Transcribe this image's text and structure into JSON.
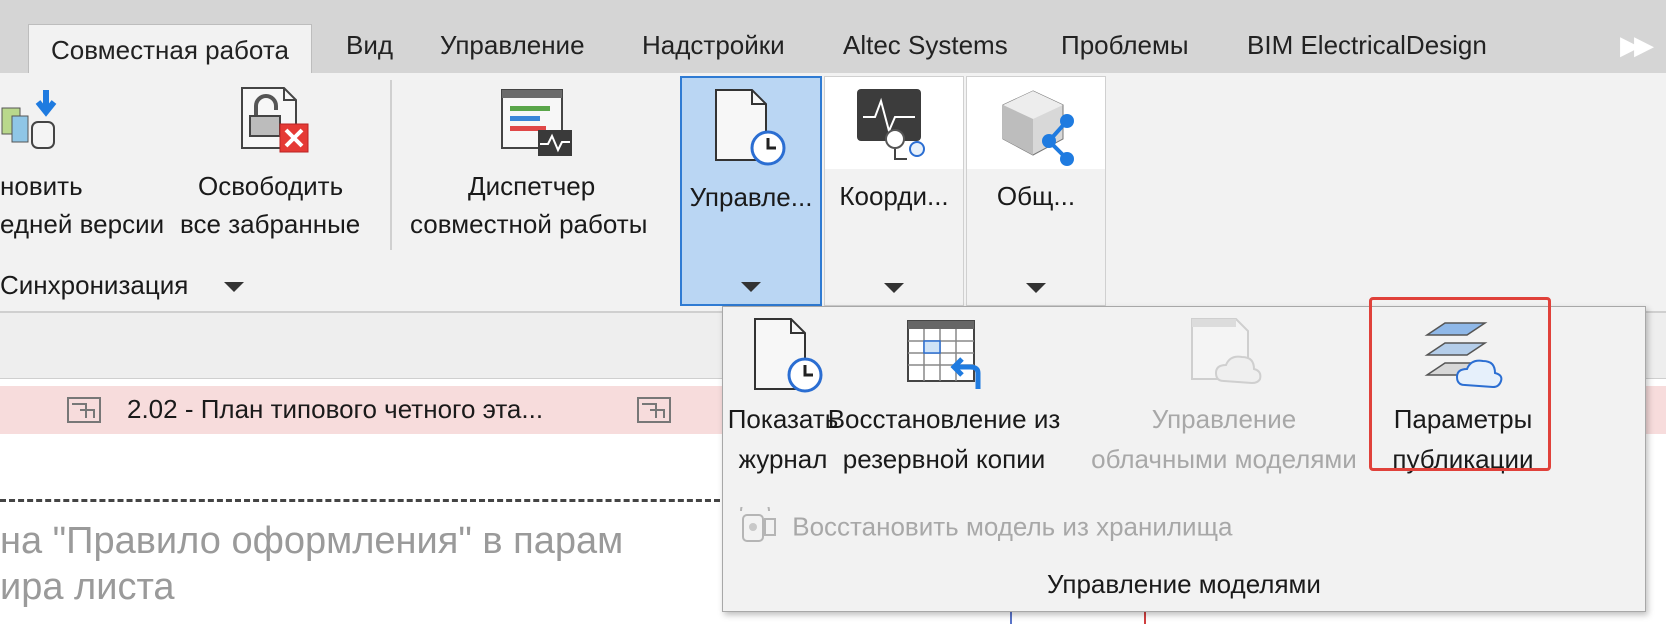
{
  "tabs": [
    {
      "label": "Совместная работа",
      "active": true
    },
    {
      "label": "Вид"
    },
    {
      "label": "Управление"
    },
    {
      "label": "Надстройки"
    },
    {
      "label": "Altec Systems"
    },
    {
      "label": "Проблемы"
    },
    {
      "label": "BIM ElectricalDesign"
    }
  ],
  "more_tabs_icon": "double-chevron-right-icon",
  "ribbon": {
    "update": {
      "line1": "новить",
      "line2": "едней версии"
    },
    "relinquish": {
      "line1": "Освободить",
      "line2": "все забранные"
    },
    "worksharing_monitor": {
      "line1": "Диспетчер",
      "line2": "совместной работы"
    },
    "manage_models_btn": "Управле...",
    "coordination_btn": "Коорди...",
    "sharing_btn": "Общ...",
    "sync_panel": "Синхронизация"
  },
  "view": {
    "sheet_row": "2.02 - План типового четного эта...",
    "big_text_line1": "на \"Правило оформления\" в парам",
    "big_text_line2": "ира листа"
  },
  "dropdown": {
    "items": [
      {
        "line1": "Показать",
        "line2": "журнал",
        "enabled": true
      },
      {
        "line1": "Восстановление из",
        "line2": "резервной копии",
        "enabled": true
      },
      {
        "line1": "Управление",
        "line2": "облачными моделями",
        "enabled": false
      },
      {
        "line1": "Параметры",
        "line2": "публикации",
        "enabled": true,
        "highlighted": true
      }
    ],
    "restore_from_storage": "Восстановить модель из хранилища",
    "panel_title": "Управление моделями"
  },
  "colors": {
    "pressed_fill": "#bad6f3",
    "pressed_border": "#2f7bd3",
    "highlight": "#e0413a",
    "sheet_row_bg": "#f7dcdc"
  }
}
